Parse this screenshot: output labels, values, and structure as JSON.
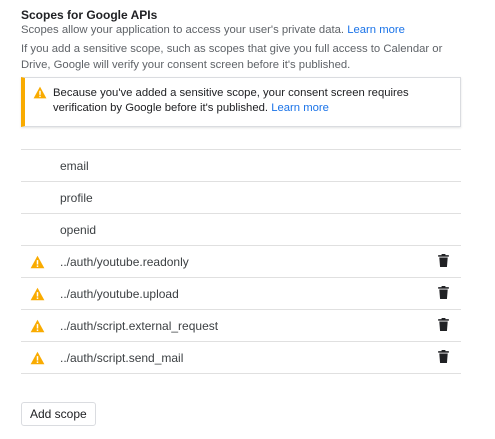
{
  "header": {
    "title": "Scopes for Google APIs",
    "description": "Scopes allow your application to access your user's private data.",
    "learn_more": "Learn more",
    "sensitive_note": "If you add a sensitive scope, such as scopes that give you full access to Calendar or Drive, Google will verify your consent screen before it's published."
  },
  "warning": {
    "text": "Because you've added a sensitive scope, your consent screen requires verification by Google before it's published.",
    "learn_more": "Learn more",
    "icon": "warning-icon",
    "accent_color": "#f9ab00"
  },
  "scopes": [
    {
      "name": "email",
      "sensitive": false,
      "deletable": false
    },
    {
      "name": "profile",
      "sensitive": false,
      "deletable": false
    },
    {
      "name": "openid",
      "sensitive": false,
      "deletable": false
    },
    {
      "name": "../auth/youtube.readonly",
      "sensitive": true,
      "deletable": true
    },
    {
      "name": "../auth/youtube.upload",
      "sensitive": true,
      "deletable": true
    },
    {
      "name": "../auth/script.external_request",
      "sensitive": true,
      "deletable": true
    },
    {
      "name": "../auth/script.send_mail",
      "sensitive": true,
      "deletable": true
    }
  ],
  "actions": {
    "add_scope_label": "Add scope"
  },
  "icons": {
    "warning": "warning-icon",
    "delete": "trash-icon"
  }
}
